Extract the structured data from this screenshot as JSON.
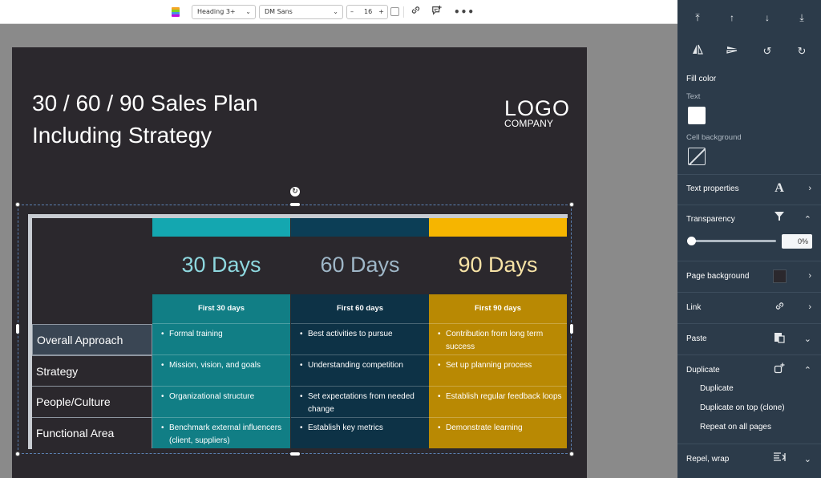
{
  "toolbar": {
    "heading_style": "Heading 3+",
    "font": "DM Sans",
    "font_size": "16",
    "minus": "–",
    "plus": "+"
  },
  "slide": {
    "title_line1": "30 / 60 / 90 Sales Plan",
    "title_line2": "Including Strategy",
    "logo_main": "LOGO",
    "logo_sub": "COMPANY",
    "columns": [
      {
        "days": "30 Days",
        "head": "First 30 days",
        "color": "#14a7b0",
        "bg": "#117e85",
        "days_color": "#8ed8df",
        "cells": [
          "Formal training",
          "Mission, vision, and goals",
          "Organizational structure",
          "Benchmark external influencers (client, suppliers)"
        ]
      },
      {
        "days": "60 Days",
        "head": "First 60 days",
        "color": "#0c3e56",
        "bg": "#0d3246",
        "days_color": "#9fb7c8",
        "cells": [
          "Best activities to pursue",
          "Understanding competition",
          "Set expectations from needed change",
          "Establish key metrics"
        ]
      },
      {
        "days": "90 Days",
        "head": "First 90 days",
        "color": "#f6b500",
        "bg": "#b98903",
        "days_color": "#f7e3a6",
        "cells": [
          "Contribution from long term success",
          "Set up planning process",
          "Establish regular feedback loops",
          "Demonstrate learning"
        ]
      }
    ],
    "rows": [
      "Overall Approach",
      "Strategy",
      "People/Culture",
      "Functional Area"
    ]
  },
  "panel": {
    "fill_color": "Fill color",
    "text": "Text",
    "cell_background": "Cell background",
    "text_properties": "Text properties",
    "transparency": "Transparency",
    "transparency_value": "0%",
    "transparency_level": 0,
    "page_background": "Page background",
    "link": "Link",
    "paste": "Paste",
    "duplicate": "Duplicate",
    "duplicate_options": [
      "Duplicate",
      "Duplicate on top (clone)",
      "Repeat on all pages"
    ],
    "repel_wrap": "Repel, wrap"
  },
  "icons": [
    "bring-to-front-icon",
    "bring-forward-icon",
    "send-backward-icon",
    "send-to-back-icon",
    "flip-horizontal-icon",
    "flip-vertical-icon",
    "rotate-left-icon",
    "rotate-right-icon",
    "link-icon",
    "comment-icon",
    "more-icon"
  ]
}
